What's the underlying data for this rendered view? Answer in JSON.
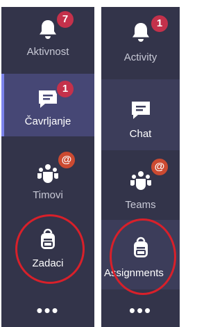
{
  "left_rail": {
    "activity": {
      "label": "Aktivnost",
      "badge": "7"
    },
    "chat": {
      "label": "Čavrljanje",
      "badge": "1"
    },
    "teams": {
      "label": "Timovi",
      "badge": "@"
    },
    "assignments": {
      "label": "Zadaci"
    },
    "more": "•••"
  },
  "right_rail": {
    "activity": {
      "label": "Activity",
      "badge": "1"
    },
    "chat": {
      "label": "Chat"
    },
    "teams": {
      "label": "Teams",
      "badge": "@"
    },
    "assignments": {
      "label": "Assignments"
    },
    "more": "•••"
  },
  "colors": {
    "rail_bg": "#33344a",
    "active_bg": "#464775",
    "badge_red": "#c4314b",
    "highlight_circle": "#d8202a"
  },
  "icons": [
    "bell-icon",
    "chat-icon",
    "teams-icon",
    "backpack-icon",
    "more-icon"
  ]
}
